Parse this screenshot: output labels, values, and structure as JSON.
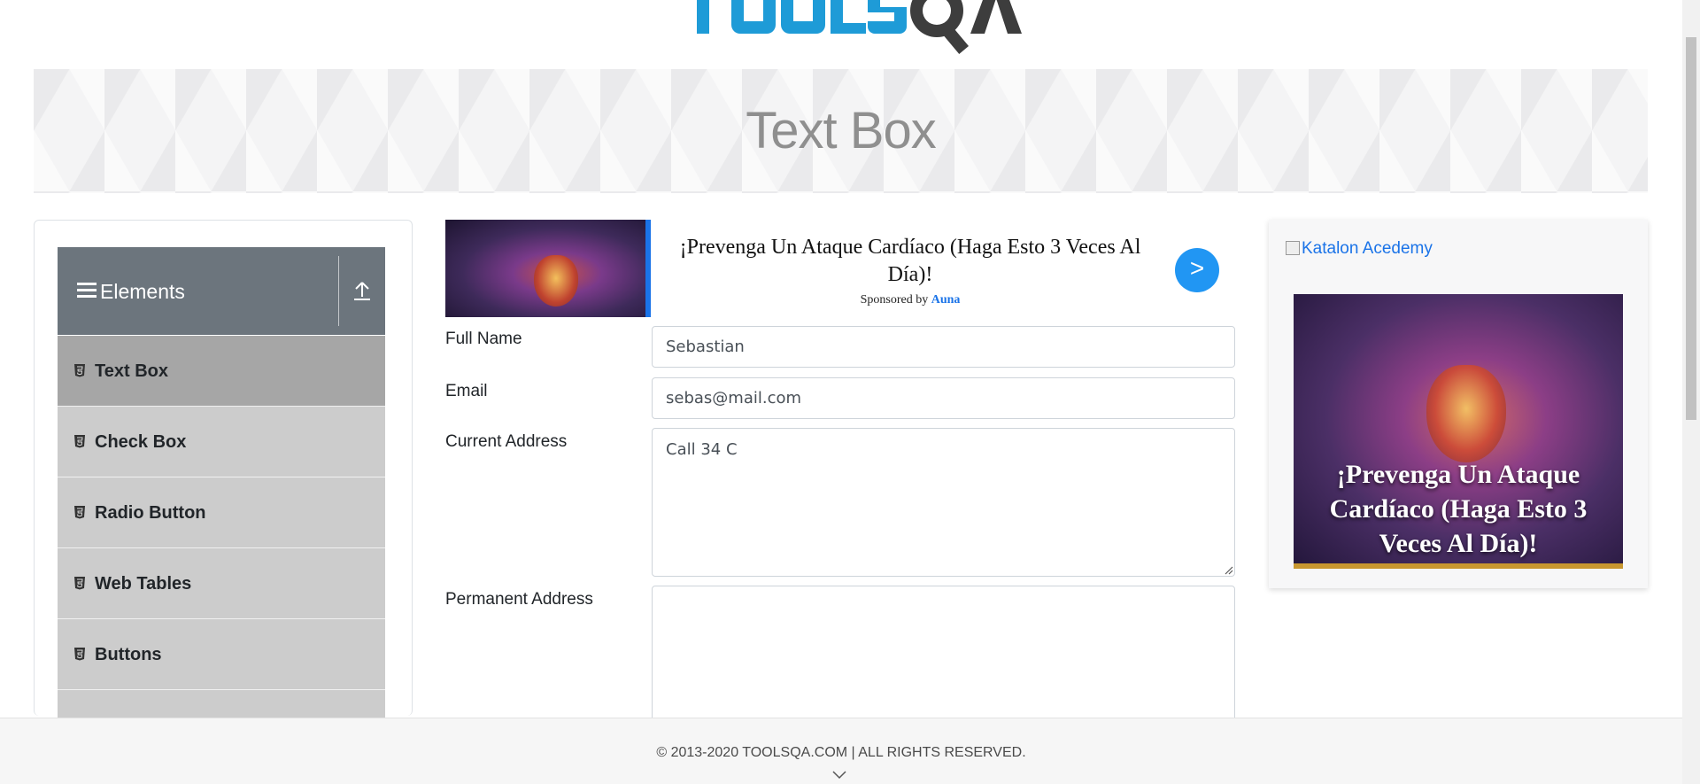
{
  "header": {
    "logo_alt": "TOOLSQA"
  },
  "banner": {
    "title": "Text Box"
  },
  "sidebar": {
    "group_title": "Elements",
    "items": [
      {
        "label": "Text Box",
        "active": true
      },
      {
        "label": "Check Box",
        "active": false
      },
      {
        "label": "Radio Button",
        "active": false
      },
      {
        "label": "Web Tables",
        "active": false
      },
      {
        "label": "Buttons",
        "active": false
      }
    ]
  },
  "top_ad": {
    "headline": "¡Prevenga Un Ataque Cardíaco (Haga Esto 3 Veces Al Día)!",
    "sponsored_prefix": "Sponsored by",
    "sponsor": "Auna",
    "cta": ">"
  },
  "form": {
    "full_name": {
      "label": "Full Name",
      "value": "Sebastian"
    },
    "email": {
      "label": "Email",
      "value": "sebas@mail.com"
    },
    "current_address": {
      "label": "Current Address",
      "value": "Call 34 C"
    },
    "permanent_address": {
      "label": "Permanent Address",
      "value": ""
    }
  },
  "right_ad": {
    "broken_image_alt": "Katalon Acedemy",
    "poster_text": "¡Prevenga Un Ataque Cardíaco (Haga Esto 3 Veces Al Día)!"
  },
  "footer": {
    "copyright": "© 2013-2020 TOOLSQA.COM | ALL RIGHTS RESERVED."
  },
  "colors": {
    "accent_blue": "#1a73e8",
    "sidebar_header": "#6c757d",
    "logo_blue": "#1e9bd7",
    "logo_dark": "#3d3d3d"
  }
}
